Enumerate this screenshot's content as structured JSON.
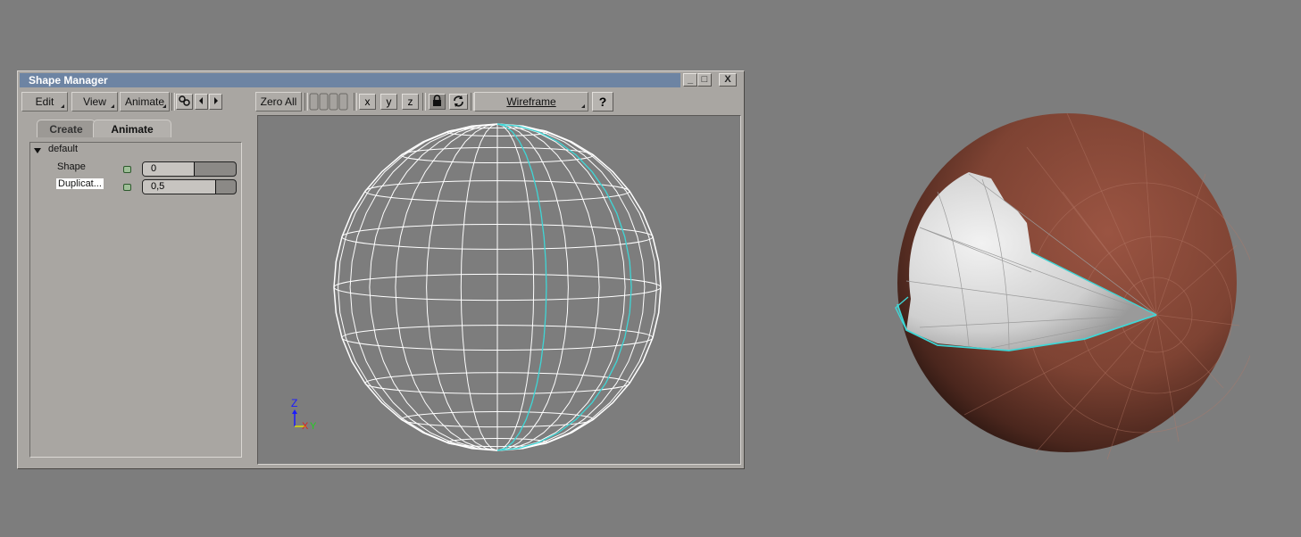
{
  "window": {
    "title": "Shape Manager",
    "buttons": {
      "minimize": "_",
      "maximize": "□",
      "close": "X"
    }
  },
  "toolbar": {
    "edit": "Edit",
    "view": "View",
    "animate": "Animate",
    "zero_all": "Zero All",
    "x": "x",
    "y": "y",
    "z": "z",
    "shading": "Wireframe",
    "help": "?"
  },
  "tabs": [
    {
      "label": "Create",
      "active": false
    },
    {
      "label": "Animate",
      "active": true
    }
  ],
  "tree": {
    "group": "default",
    "items": [
      {
        "label": "Shape",
        "value": "0",
        "level": 0.0
      },
      {
        "label": "Duplicat...",
        "value": "0,5",
        "level": 0.5
      }
    ]
  },
  "axis": {
    "z": "Z",
    "x": "X",
    "y": "Y"
  },
  "colors": {
    "background": "#7d7d7d",
    "title_bar": "#6d84a3",
    "selection_edge": "#3fd6d6",
    "sphere_surface": "#8a4a39",
    "sphere_inner": "#d9d9d9"
  }
}
